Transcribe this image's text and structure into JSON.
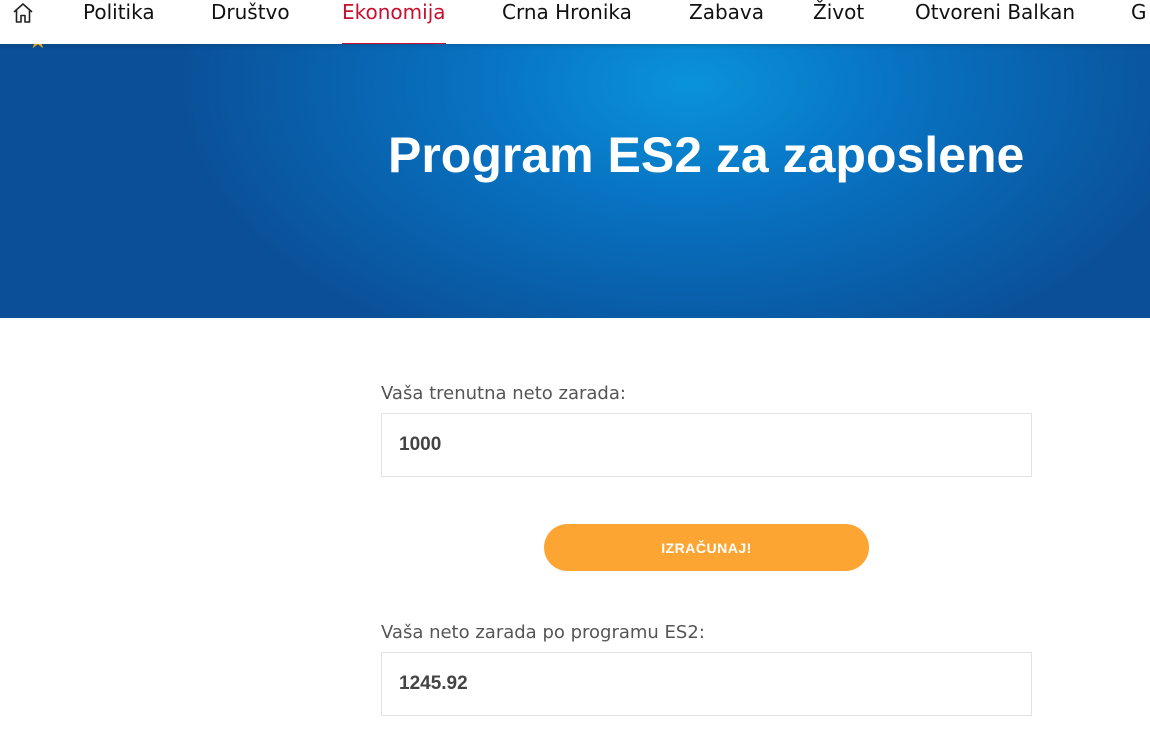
{
  "topnav": {
    "items": [
      {
        "label": "Politika"
      },
      {
        "label": "Društvo"
      },
      {
        "label": "Ekonomija",
        "active": true
      },
      {
        "label": "Crna Hronika"
      },
      {
        "label": "Zabava"
      },
      {
        "label": "Život"
      },
      {
        "label": "Otvoreni Balkan"
      },
      {
        "label": "G"
      }
    ],
    "active_color": "#c8102e"
  },
  "hero": {
    "title": "Program ES2 za zaposlene"
  },
  "form": {
    "current_label": "Vaša trenutna neto zarada:",
    "current_value": "1000",
    "button_label": "IZRAČUNAJ!",
    "result_label": "Vaša neto zarada po programu ES2:",
    "result_value": "1245.92"
  },
  "colors": {
    "hero_blue": "#0873c2",
    "button_orange": "#fda533"
  }
}
